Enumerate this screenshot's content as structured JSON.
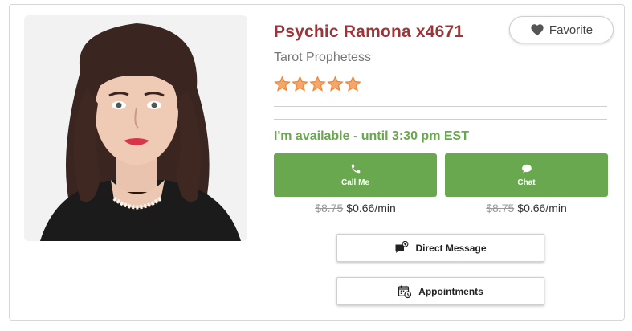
{
  "profile": {
    "name": "Psychic Ramona x4671",
    "title": "Tarot Prophetess",
    "rating_stars": 5,
    "rating_max": 5,
    "availability": "I'm available - until 3:30 pm EST",
    "photo_icon": "psychic-portrait"
  },
  "favorite": {
    "label": "Favorite",
    "icon": "heart-icon"
  },
  "actions": {
    "call": {
      "label": "Call Me",
      "icon": "phone-icon",
      "old_price": "$8.75",
      "price": "$0.66/min"
    },
    "chat": {
      "label": "Chat",
      "icon": "chat-bubble-icon",
      "old_price": "$8.75",
      "price": "$0.66/min"
    }
  },
  "direct_message": {
    "label": "Direct Message",
    "icon": "message-plus-icon"
  },
  "appointments": {
    "label": "Appointments",
    "icon": "calendar-clock-icon"
  },
  "colors": {
    "name": "#9e3338",
    "accent_green": "#6aa84f",
    "star": "#f0883a",
    "subtitle": "#777777"
  }
}
